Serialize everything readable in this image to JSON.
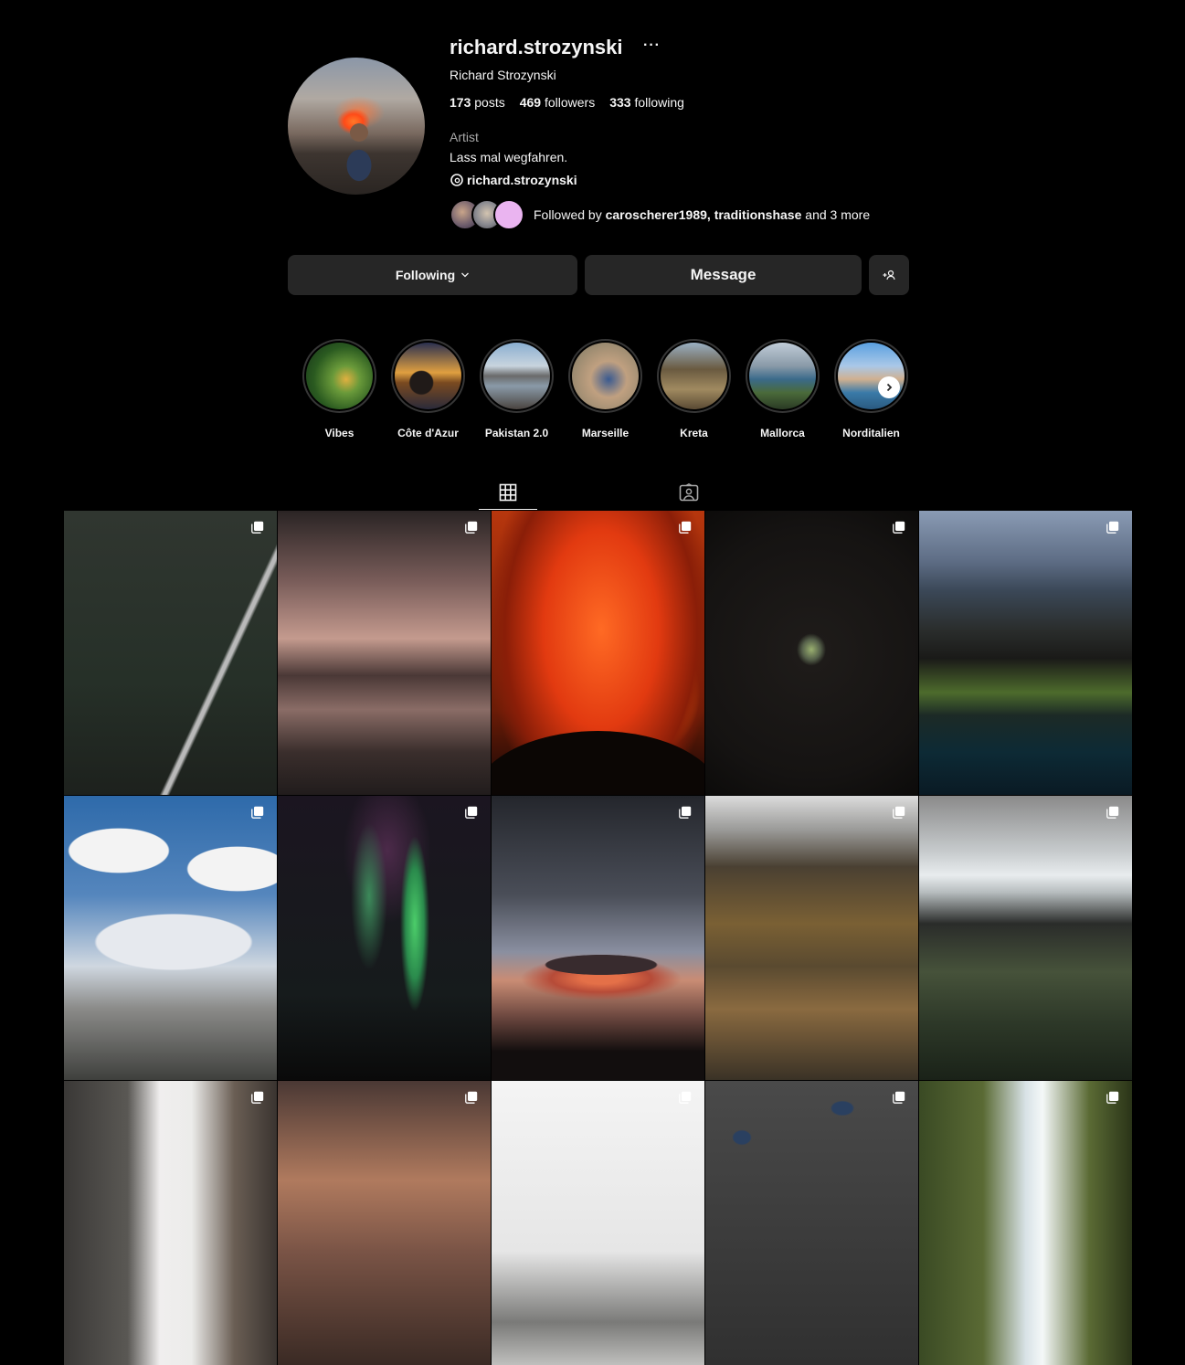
{
  "profile": {
    "username": "richard.strozynski",
    "more": "···",
    "full_name": "Richard Strozynski",
    "posts_count": "173",
    "posts_label": "posts",
    "followers_count": "469",
    "followers_label": "followers",
    "following_count": "333",
    "following_label": "following",
    "category": "Artist",
    "bio": "Lass mal wegfahren.",
    "threads_handle": "richard.strozynski",
    "followed_by_prefix": "Followed by",
    "followed_by_user1": "caroscherer1989",
    "followed_by_sep": ",",
    "followed_by_user2": "traditionshase",
    "followed_by_suffix": "and 3 more"
  },
  "actions": {
    "following_label": "Following",
    "message_label": "Message",
    "add_user_icon": "add-person-icon"
  },
  "highlights": [
    {
      "label": "Vibes"
    },
    {
      "label": "Côte d'Azur"
    },
    {
      "label": "Pakistan 2.0"
    },
    {
      "label": "Marseille"
    },
    {
      "label": "Kreta"
    },
    {
      "label": "Mallorca"
    },
    {
      "label": "Norditalien"
    }
  ],
  "tabs": [
    {
      "icon": "grid-icon",
      "active": true
    },
    {
      "icon": "tagged-icon",
      "active": false
    }
  ],
  "posts": {
    "count_visible": 15,
    "all_multi_image": true
  },
  "colors": {
    "background": "#000000",
    "button_bg": "#262626",
    "text_primary": "#f5f5f5",
    "text_secondary": "#a8a8a8"
  }
}
